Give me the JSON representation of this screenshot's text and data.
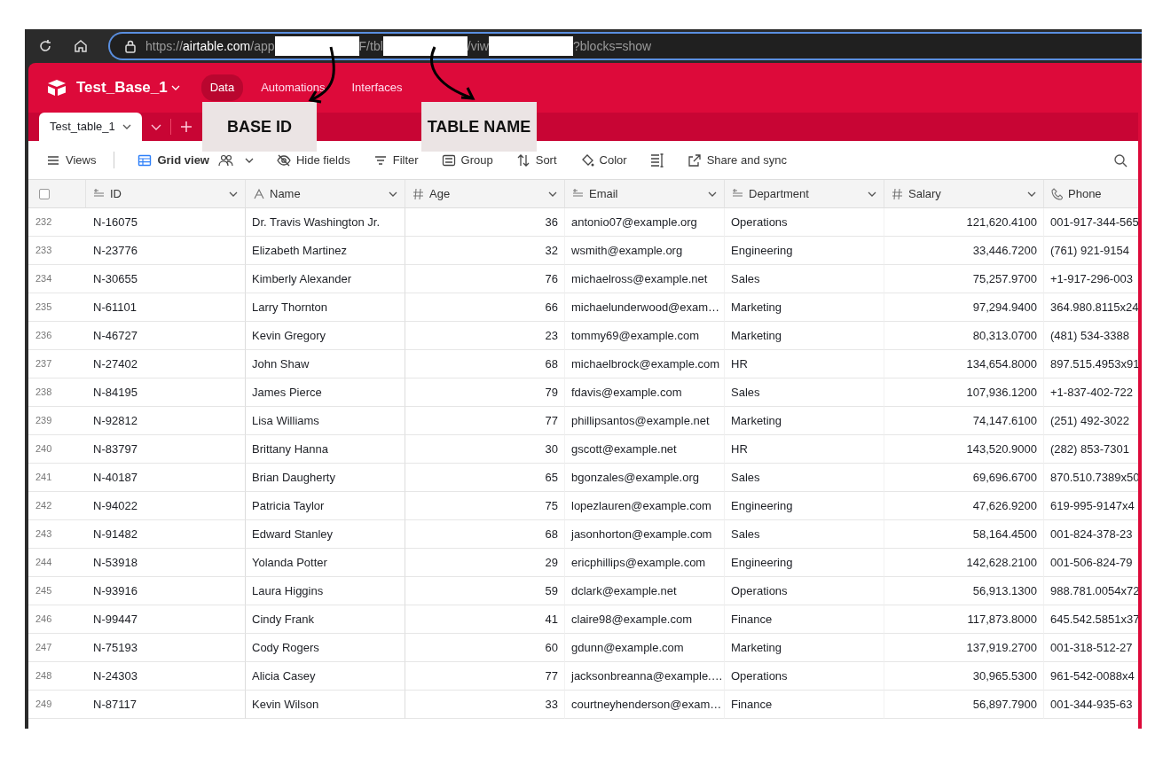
{
  "browser": {
    "url": [
      {
        "kind": "dim",
        "text": "https://"
      },
      {
        "kind": "host",
        "text": "airtable.com"
      },
      {
        "kind": "dim",
        "text": "/app"
      },
      {
        "kind": "redacted"
      },
      {
        "kind": "dim",
        "text": "F/tbl"
      },
      {
        "kind": "redacted"
      },
      {
        "kind": "dim",
        "text": "/viw"
      },
      {
        "kind": "redacted"
      },
      {
        "kind": "dim",
        "text": "?blocks=show"
      }
    ]
  },
  "base": {
    "name": "Test_Base_1"
  },
  "nav": [
    {
      "label": "Data",
      "selected": true
    },
    {
      "label": "Automations",
      "selected": false
    },
    {
      "label": "Interfaces",
      "selected": false
    }
  ],
  "tables": [
    {
      "label": "Test_table_1",
      "selected": true
    }
  ],
  "toolbar": [
    {
      "kind": "views",
      "label": "Views"
    },
    {
      "kind": "grid",
      "label": "Grid view"
    },
    {
      "kind": "hide",
      "label": "Hide fields"
    },
    {
      "kind": "filter",
      "label": "Filter"
    },
    {
      "kind": "group",
      "label": "Group"
    },
    {
      "kind": "sort",
      "label": "Sort"
    },
    {
      "kind": "color",
      "label": "Color"
    },
    {
      "kind": "height"
    },
    {
      "kind": "share",
      "label": "Share and sync"
    }
  ],
  "select_all": {
    "checked": false
  },
  "columns": [
    {
      "kind": "text",
      "label": "ID"
    },
    {
      "kind": "name",
      "label": "Name"
    },
    {
      "kind": "number",
      "label": "Age"
    },
    {
      "kind": "text",
      "label": "Email"
    },
    {
      "kind": "text",
      "label": "Department"
    },
    {
      "kind": "number",
      "label": "Salary"
    },
    {
      "kind": "phone",
      "label": "Phone"
    }
  ],
  "rows": [
    {
      "num": "232",
      "cells": [
        "N-16075",
        "Dr. Travis Washington Jr.",
        "36",
        "antonio07@example.org",
        "Operations",
        "121,620.4100",
        "001-917-344-565"
      ]
    },
    {
      "num": "233",
      "cells": [
        "N-23776",
        "Elizabeth Martinez",
        "32",
        "wsmith@example.org",
        "Engineering",
        "33,446.7200",
        "(761) 921-9154"
      ]
    },
    {
      "num": "234",
      "cells": [
        "N-30655",
        "Kimberly Alexander",
        "76",
        "michaelross@example.net",
        "Sales",
        "75,257.9700",
        "+1-917-296-003"
      ]
    },
    {
      "num": "235",
      "cells": [
        "N-61101",
        "Larry Thornton",
        "66",
        "michaelunderwood@exam…",
        "Marketing",
        "97,294.9400",
        "364.980.8115x24"
      ]
    },
    {
      "num": "236",
      "cells": [
        "N-46727",
        "Kevin Gregory",
        "23",
        "tommy69@example.com",
        "Marketing",
        "80,313.0700",
        "(481) 534-3388"
      ]
    },
    {
      "num": "237",
      "cells": [
        "N-27402",
        "John Shaw",
        "68",
        "michaelbrock@example.com",
        "HR",
        "134,654.8000",
        "897.515.4953x91"
      ]
    },
    {
      "num": "238",
      "cells": [
        "N-84195",
        "James Pierce",
        "79",
        "fdavis@example.com",
        "Sales",
        "107,936.1200",
        "+1-837-402-722"
      ]
    },
    {
      "num": "239",
      "cells": [
        "N-92812",
        "Lisa Williams",
        "77",
        "phillipsantos@example.net",
        "Marketing",
        "74,147.6100",
        "(251) 492-3022"
      ]
    },
    {
      "num": "240",
      "cells": [
        "N-83797",
        "Brittany Hanna",
        "30",
        "gscott@example.net",
        "HR",
        "143,520.9000",
        "(282) 853-7301"
      ]
    },
    {
      "num": "241",
      "cells": [
        "N-40187",
        "Brian Daugherty",
        "65",
        "bgonzales@example.org",
        "Sales",
        "69,696.6700",
        "870.510.7389x50"
      ]
    },
    {
      "num": "242",
      "cells": [
        "N-94022",
        "Patricia Taylor",
        "75",
        "lopezlauren@example.com",
        "Engineering",
        "47,626.9200",
        "619-995-9147x4"
      ]
    },
    {
      "num": "243",
      "cells": [
        "N-91482",
        "Edward Stanley",
        "68",
        "jasonhorton@example.com",
        "Sales",
        "58,164.4500",
        "001-824-378-23"
      ]
    },
    {
      "num": "244",
      "cells": [
        "N-53918",
        "Yolanda Potter",
        "29",
        "ericphillips@example.com",
        "Engineering",
        "142,628.2100",
        "001-506-824-79"
      ]
    },
    {
      "num": "245",
      "cells": [
        "N-93916",
        "Laura Higgins",
        "59",
        "dclark@example.net",
        "Operations",
        "56,913.1300",
        "988.781.0054x72"
      ]
    },
    {
      "num": "246",
      "cells": [
        "N-99447",
        "Cindy Frank",
        "41",
        "claire98@example.com",
        "Finance",
        "117,873.8000",
        "645.542.5851x37"
      ]
    },
    {
      "num": "247",
      "cells": [
        "N-75193",
        "Cody Rogers",
        "60",
        "gdunn@example.com",
        "Marketing",
        "137,919.2700",
        "001-318-512-27"
      ]
    },
    {
      "num": "248",
      "cells": [
        "N-24303",
        "Alicia Casey",
        "77",
        "jacksonbreanna@example.…",
        "Operations",
        "30,965.5300",
        "961-542-0088x4"
      ]
    },
    {
      "num": "249",
      "cells": [
        "N-87117",
        "Kevin Wilson",
        "33",
        "courtneyhenderson@exam…",
        "Finance",
        "56,897.7900",
        "001-344-935-63"
      ]
    }
  ],
  "annotations": [
    {
      "label": "BASE ID"
    },
    {
      "label": "TABLE NAME"
    }
  ]
}
